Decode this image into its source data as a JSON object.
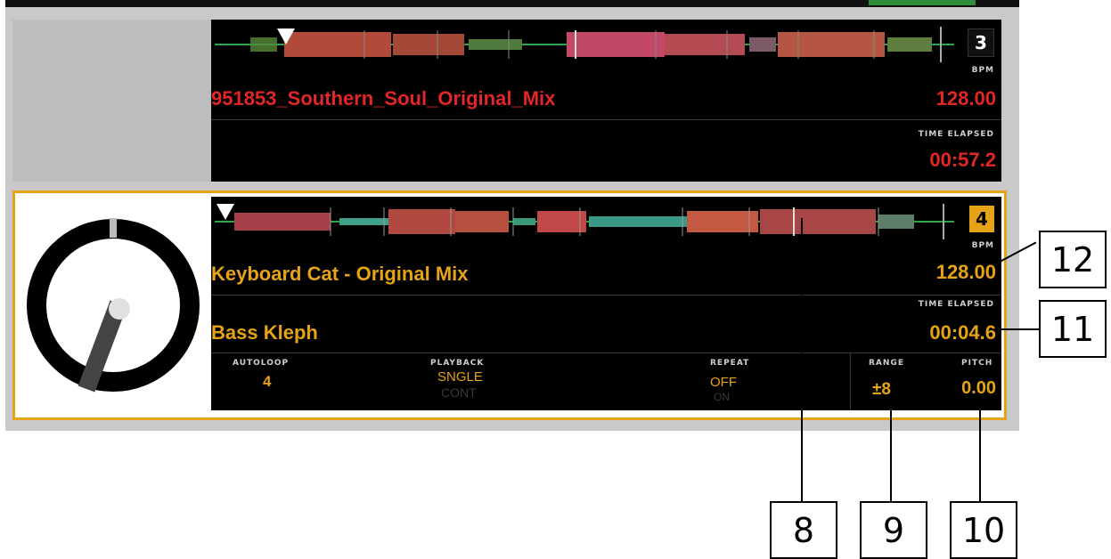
{
  "deck3": {
    "number": "3",
    "track_title": "951853_Southern_Soul_Original_Mix",
    "bpm_label": "BPM",
    "bpm_value": "128.00",
    "time_label": "TIME ELAPSED",
    "time_value": "00:57.2"
  },
  "deck4": {
    "number": "4",
    "track_title": "Keyboard Cat - Original Mix",
    "artist": "Bass Kleph",
    "bpm_label": "BPM",
    "bpm_value": "128.00",
    "time_label": "TIME ELAPSED",
    "time_value": "00:04.6",
    "autoloop_label": "AUTOLOOP",
    "autoloop_value": "4",
    "playback_label": "PLAYBACK",
    "playback_active": "SNGLE",
    "playback_inactive": "CONT",
    "repeat_label": "REPEAT",
    "repeat_active": "OFF",
    "repeat_inactive": "ON",
    "range_label": "RANGE",
    "range_value": "±8",
    "pitch_label": "PITCH",
    "pitch_value": "0.00"
  },
  "callouts": {
    "c8": "8",
    "c9": "9",
    "c10": "10",
    "c11": "11",
    "c12": "12"
  },
  "colors": {
    "deck3_accent": "#e32626",
    "deck4_accent": "#e6a318"
  },
  "icons": {
    "playhead": "triangle-down-icon",
    "jog": "jog-wheel-icon"
  }
}
